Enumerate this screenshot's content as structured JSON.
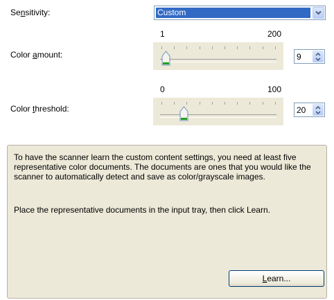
{
  "sensitivity": {
    "label_pre": "Se",
    "label_key": "n",
    "label_post": "sitivity:",
    "value": "Custom"
  },
  "color_amount": {
    "min_label": "1",
    "max_label": "200",
    "label_pre": "Color ",
    "label_key": "a",
    "label_post": "mount:",
    "value": "9",
    "slider_value": 9,
    "min": 1,
    "max": 200
  },
  "color_threshold": {
    "min_label": "0",
    "max_label": "100",
    "label_pre": "Color ",
    "label_key": "t",
    "label_post": "hreshold:",
    "value": "20",
    "slider_value": 20,
    "min": 0,
    "max": 100
  },
  "info": {
    "paragraph1": "To have the scanner learn the custom content settings, you need at least five representative color documents. The documents are ones that you would like the scanner to automatically detect and save as color/grayscale images.",
    "paragraph2": "Place the representative documents in the input tray, then click Learn."
  },
  "learn_button": {
    "key": "L",
    "rest": "earn..."
  },
  "colors": {
    "selection": "#316ac5",
    "panel_bg": "#ece9d8",
    "thumb_green": "#21a121"
  }
}
